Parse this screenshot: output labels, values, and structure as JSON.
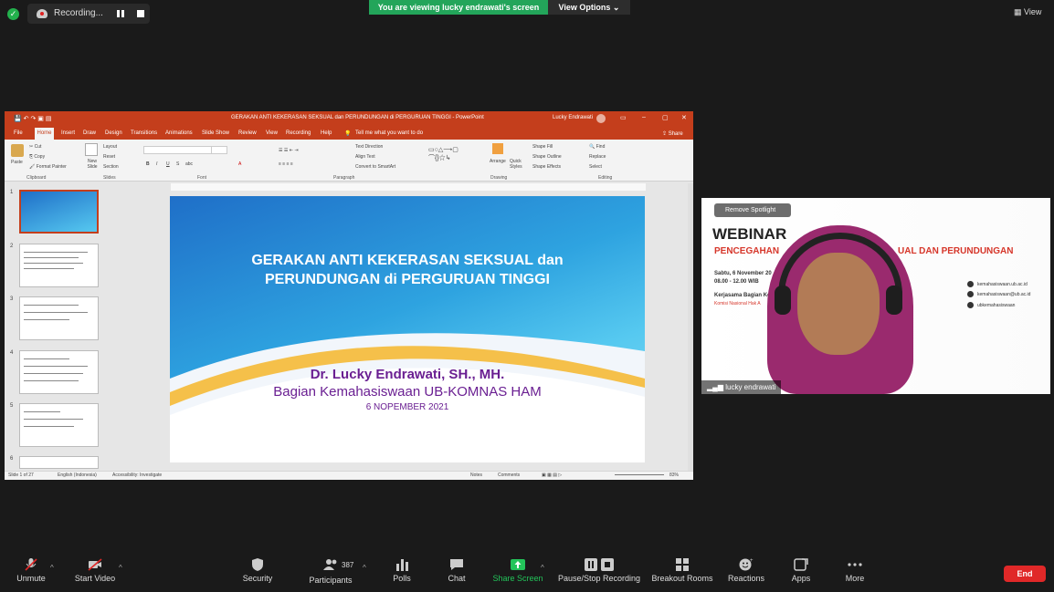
{
  "top_bar": {
    "recording_label": "Recording...",
    "viewing_banner": "You are viewing lucky endrawati's screen",
    "view_options": "View Options",
    "view_label": "View"
  },
  "powerpoint": {
    "title": "GERAKAN ANTI KEKERASAN SEKSUAL dan PERUNDUNGAN di PERGURUAN TINGGI  -  PowerPoint",
    "user": "Lucky Endrawati",
    "menu": [
      "File",
      "Home",
      "Insert",
      "Draw",
      "Design",
      "Transitions",
      "Animations",
      "Slide Show",
      "Review",
      "View",
      "Recording",
      "Help"
    ],
    "tell_me": "Tell me what you want to do",
    "share": "Share",
    "ribbon": {
      "paste": "Paste",
      "cut": "Cut",
      "copy": "Copy",
      "format_painter": "Format Painter",
      "new_slide": "New Slide",
      "layout": "Layout",
      "reset": "Reset",
      "section": "Section",
      "text_direction": "Text Direction",
      "align_text": "Align Text",
      "convert_smartart": "Convert to SmartArt",
      "arrange": "Arrange",
      "quick_styles": "Quick Styles",
      "shape_fill": "Shape Fill",
      "shape_outline": "Shape Outline",
      "shape_effects": "Shape Effects",
      "find": "Find",
      "replace": "Replace",
      "select": "Select",
      "groups": [
        "Clipboard",
        "Slides",
        "Font",
        "Paragraph",
        "Drawing",
        "Editing"
      ]
    },
    "slide_numbers": [
      "1",
      "2",
      "3",
      "4",
      "5",
      "6"
    ],
    "slide": {
      "title_line1": "GERAKAN ANTI KEKERASAN SEKSUAL dan",
      "title_line2": "PERUNDUNGAN di PERGURUAN TINGGI",
      "presenter": "Dr. Lucky Endrawati, SH., MH.",
      "department": "Bagian Kemahasiswaan UB-KOMNAS HAM",
      "date": "6 NOPEMBER 2021"
    },
    "status": {
      "slide_count": "Slide 1 of 27",
      "language": "English (Indonesia)",
      "accessibility": "Accessibility: Investigate",
      "notes": "Notes",
      "comments": "Comments",
      "zoom": "83%"
    }
  },
  "video": {
    "remove_spotlight": "Remove Spotlight",
    "webinar": "WEBINAR",
    "subtitle": "PENCEGAHAN",
    "subtitle_tail": "UAL DAN PERUNDUNGAN",
    "date_line": "Sabtu, 6 November 20",
    "time_line": "08.00 - 12.00 WIB",
    "kerjasama": "Kerjasama Bagian Ke",
    "komisi": "Komisi Nasional Hak A",
    "contacts": [
      "kemahasiswaan.ub.ac.id",
      "kemahasiswaan@ub.ac.id",
      "ubkemahasiswaan"
    ],
    "participant_name": "lucky endrawati"
  },
  "toolbar": {
    "unmute": "Unmute",
    "start_video": "Start Video",
    "security": "Security",
    "participants": "Participants",
    "participants_count": "387",
    "polls": "Polls",
    "chat": "Chat",
    "share_screen": "Share Screen",
    "pause_stop": "Pause/Stop Recording",
    "breakout": "Breakout Rooms",
    "reactions": "Reactions",
    "apps": "Apps",
    "more": "More",
    "end": "End"
  },
  "colors": {
    "ppt_accent": "#c43e1c",
    "zoom_green": "#23a55a",
    "end_red": "#e02828",
    "slide_text_purple": "#6a1f92"
  }
}
